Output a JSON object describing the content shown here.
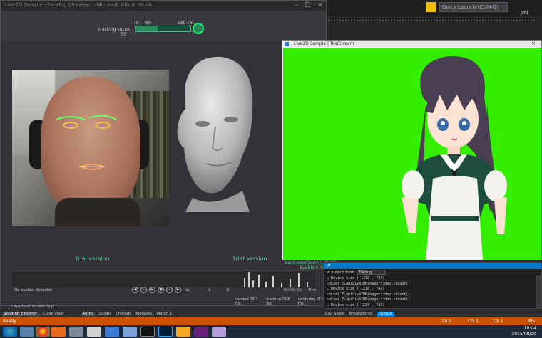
{
  "vs": {
    "quick_launch": "Quick Launch (Ctrl+Q)",
    "user": "jml"
  },
  "tracker": {
    "title": "Live2D Sample - FaceRig (Preview) - Microsoft Visual Studio",
    "tracking_label": "tracking succe",
    "scale_70": "70",
    "scale_90": "90",
    "scale_150": "150 cm",
    "scale_55": "55",
    "tracking_level_percent": 40,
    "trial_left": "trial version",
    "trial_right": "trial version",
    "no_motion": "No cuckoo detector",
    "readout_x": "1x",
    "readout_1": "-1",
    "readout_2": "8",
    "readout_time": "00:00:00",
    "readout_trim": "Trim",
    "fps_camera": "camera  29.3 fps",
    "fps_tracking": "tracking  29.8 fps",
    "fps_render": "rendering  21.4 fps",
    "blend_1": "LipsLowerDown_L (0.00)",
    "blend_2": "EyeBlink_R (0.00)"
  },
  "live2d": {
    "title": "Live2D Sample | TestStream"
  },
  "output": {
    "header": "ut",
    "from_label": "w output from:",
    "from_value": "Debug",
    "lines": [
      "  L Device size ( 1216 , 741)",
      "  coLost ELApiLive2DManager::deviceLost()",
      "  L Device size ( 1216 , 741)",
      "  coLost ELApiLive2DManager::deviceLost()",
      "  coLost ELApiLive2DManager::deviceLost()",
      "  L Device size ( 1220 , 741)"
    ]
  },
  "tabs_left": {
    "solution_explorer": "Solution Explorer",
    "class_view": "Class View",
    "autos": "Autos",
    "locals": "Locals",
    "threads": "Threads",
    "modules": "Modules",
    "watch": "Watch 1"
  },
  "tabs_right": {
    "call_stack": "Call Stack",
    "breakpoints": "Breakpoints",
    "output": "Output"
  },
  "file_tab": "LAppTextureDesc.cpp",
  "status": {
    "ready": "Ready",
    "ln": "Ln 1",
    "col": "Col 1",
    "ch": "Ch 1",
    "ins": "INS"
  },
  "taskbar": {
    "time": "18:04",
    "date": "2015/08/20"
  },
  "colors": {
    "accent": "#007acc",
    "status": "#ca5100",
    "greenscreen": "#33ee00",
    "tracker_green": "#5ecfa0"
  }
}
